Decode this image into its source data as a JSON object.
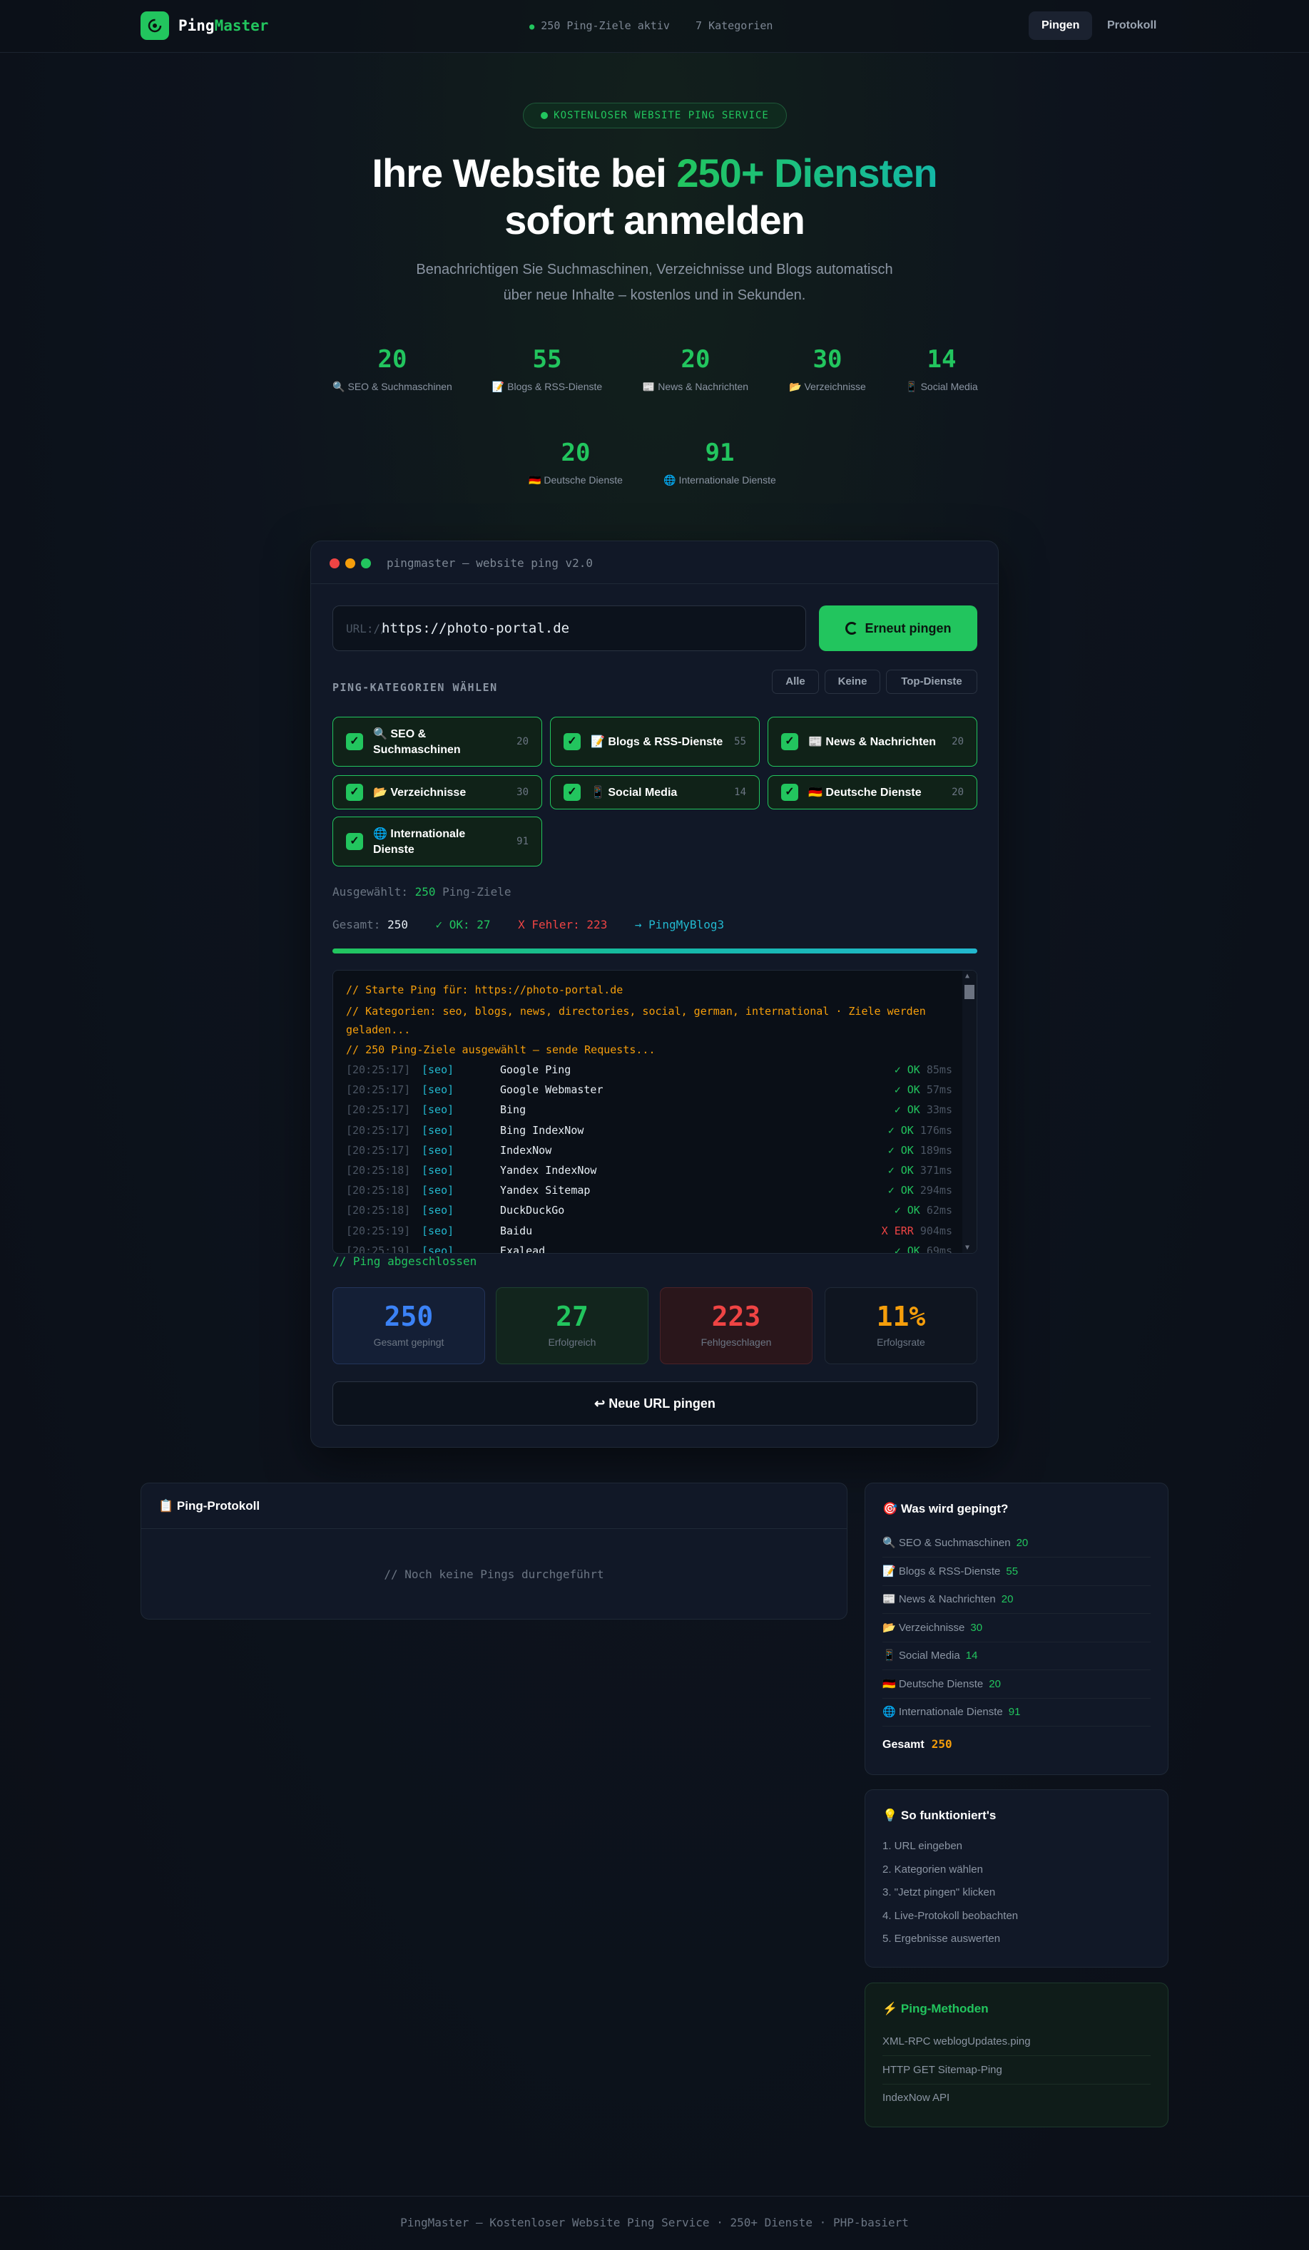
{
  "nav": {
    "logo_part1": "Ping",
    "logo_part2": "Master",
    "meta_targets": "250 Ping-Ziele aktiv",
    "meta_categories": "7 Kategorien",
    "btn_ping": "Pingen",
    "btn_protokoll": "Protokoll"
  },
  "hero": {
    "badge": "KOSTENLOSER WEBSITE PING SERVICE",
    "title_a": "Ihre Website bei ",
    "title_highlight": "250+ Diensten",
    "title_b": "sofort anmelden",
    "subtitle_1": "Benachrichtigen Sie Suchmaschinen, Verzeichnisse und Blogs automatisch",
    "subtitle_2": "über neue Inhalte – kostenlos und in Sekunden."
  },
  "stats": [
    {
      "num": "20",
      "label": "🔍 SEO & Suchmaschinen"
    },
    {
      "num": "55",
      "label": "📝 Blogs & RSS-Dienste"
    },
    {
      "num": "20",
      "label": "📰 News & Nachrichten"
    },
    {
      "num": "30",
      "label": "📂 Verzeichnisse"
    },
    {
      "num": "14",
      "label": "📱 Social Media"
    },
    {
      "num": "20",
      "label": "🇩🇪 Deutsche Dienste"
    },
    {
      "num": "91",
      "label": "🌐 Internationale Dienste"
    }
  ],
  "panel": {
    "title": "pingmaster — website ping v2.0",
    "url_prefix": "URL://",
    "url_value": "https://photo-portal.de",
    "go_button": "Erneut pingen",
    "categories_label": "PING-KATEGORIEN WÄHLEN",
    "quick_all": "Alle",
    "quick_none": "Keine",
    "quick_top": "Top-Dienste",
    "categories": [
      {
        "name1": "🔍 SEO &",
        "name2": "Suchmaschinen",
        "count": "20"
      },
      {
        "name1": "📝 Blogs & RSS-Dienste",
        "name2": "",
        "count": "55"
      },
      {
        "name1": "📰 News & Nachrichten",
        "name2": "",
        "count": "20"
      },
      {
        "name1": "📂 Verzeichnisse",
        "name2": "",
        "count": "30"
      },
      {
        "name1": "📱 Social Media",
        "name2": "",
        "count": "14"
      },
      {
        "name1": "🇩🇪 Deutsche Dienste",
        "name2": "",
        "count": "20"
      },
      {
        "name1": "🌐 Internationale",
        "name2": "Dienste",
        "count": "91"
      }
    ],
    "check_mark": "✓",
    "selected_prefix": "Ausgewählt: ",
    "selected_count": "250",
    "selected_suffix": " Ping-Ziele",
    "total_label": "Gesamt: ",
    "total_value": "250",
    "ok_label": "✓ OK: 27",
    "err_label": "X Fehler: 223",
    "current": "→ PingMyBlog3",
    "progress": 1.0,
    "log_comments": [
      "// Starte Ping für: https://photo-portal.de",
      "// Kategorien: seo, blogs, news, directories, social, german, international · Ziele werden",
      "geladen...",
      "// 250 Ping-Ziele ausgewählt – sende Requests..."
    ],
    "log_rows": [
      {
        "time": "[20:25:17]",
        "cat": "[seo]",
        "name": "Google Ping",
        "status": "✓ OK",
        "ms": "85ms",
        "err": false
      },
      {
        "time": "[20:25:17]",
        "cat": "[seo]",
        "name": "Google Webmaster",
        "status": "✓ OK",
        "ms": "57ms",
        "err": false
      },
      {
        "time": "[20:25:17]",
        "cat": "[seo]",
        "name": "Bing",
        "status": "✓ OK",
        "ms": "33ms",
        "err": false
      },
      {
        "time": "[20:25:17]",
        "cat": "[seo]",
        "name": "Bing IndexNow",
        "status": "✓ OK",
        "ms": "176ms",
        "err": false
      },
      {
        "time": "[20:25:17]",
        "cat": "[seo]",
        "name": "IndexNow",
        "status": "✓ OK",
        "ms": "189ms",
        "err": false
      },
      {
        "time": "[20:25:18]",
        "cat": "[seo]",
        "name": "Yandex IndexNow",
        "status": "✓ OK",
        "ms": "371ms",
        "err": false
      },
      {
        "time": "[20:25:18]",
        "cat": "[seo]",
        "name": "Yandex Sitemap",
        "status": "✓ OK",
        "ms": "294ms",
        "err": false
      },
      {
        "time": "[20:25:18]",
        "cat": "[seo]",
        "name": "DuckDuckGo",
        "status": "✓ OK",
        "ms": "62ms",
        "err": false
      },
      {
        "time": "[20:25:19]",
        "cat": "[seo]",
        "name": "Baidu",
        "status": "X ERR",
        "ms": "904ms",
        "err": true
      },
      {
        "time": "[20:25:19]",
        "cat": "[seo]",
        "name": "Exalead",
        "status": "✓ OK",
        "ms": "69ms",
        "err": false
      }
    ],
    "done": "// Ping abgeschlossen",
    "cards": [
      {
        "num": "250",
        "label": "Gesamt gepingt"
      },
      {
        "num": "27",
        "label": "Erfolgreich"
      },
      {
        "num": "223",
        "label": "Fehlgeschlagen"
      },
      {
        "num": "11%",
        "label": "Erfolgsrate"
      }
    ],
    "new_button": "↩ Neue URL pingen"
  },
  "protokoll": {
    "title": "📋 Ping-Protokoll",
    "empty": "// Noch keine Pings durchgeführt"
  },
  "sidebar": {
    "what_title": "🎯 Was wird gepingt?",
    "what_items": [
      {
        "label": "🔍 SEO & Suchmaschinen",
        "count": "20"
      },
      {
        "label": "📝 Blogs & RSS-Dienste",
        "count": "55"
      },
      {
        "label": "📰 News & Nachrichten",
        "count": "20"
      },
      {
        "label": "📂 Verzeichnisse",
        "count": "30"
      },
      {
        "label": "📱 Social Media",
        "count": "14"
      },
      {
        "label": "🇩🇪 Deutsche Dienste",
        "count": "20"
      },
      {
        "label": "🌐 Internationale Dienste",
        "count": "91"
      }
    ],
    "total_label": "Gesamt",
    "total_value": "250",
    "how_title": "💡 So funktioniert's",
    "how_steps": [
      "1. URL eingeben",
      "2. Kategorien wählen",
      "3. \"Jetzt pingen\" klicken",
      "4. Live-Protokoll beobachten",
      "5. Ergebnisse auswerten"
    ],
    "methods_title": "⚡ Ping-Methoden",
    "methods": [
      "XML-RPC weblogUpdates.ping",
      "HTTP GET Sitemap-Ping",
      "IndexNow API"
    ]
  },
  "footer": "PingMaster — Kostenloser Website Ping Service · 250+ Dienste · PHP-basiert",
  "colors": {
    "accent": "#22c55e",
    "teal": "#14b8a6",
    "error": "#ef4444",
    "warning": "#f59e0b",
    "info": "#3b82f6"
  }
}
